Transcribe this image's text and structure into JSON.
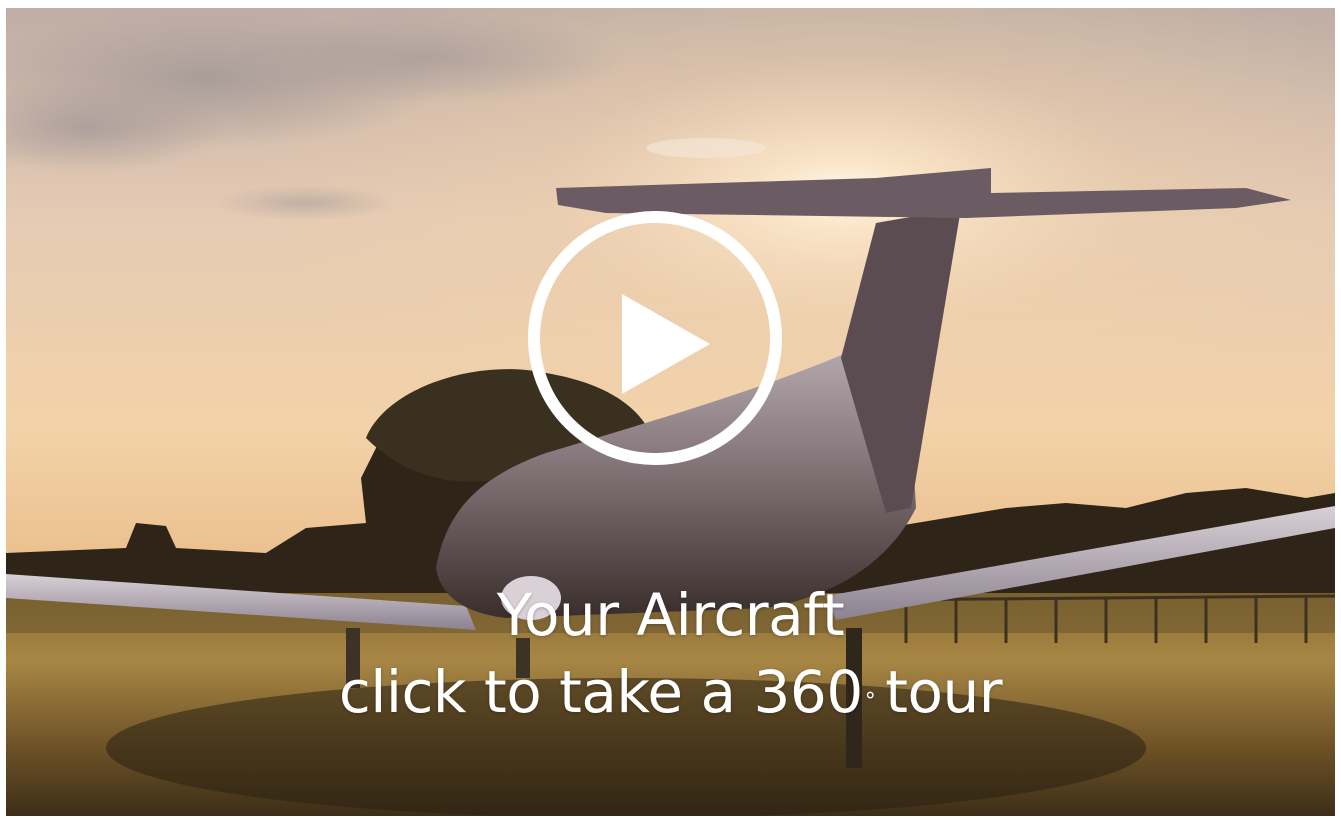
{
  "video": {
    "title": "Your Aircraft",
    "subtitle_pre": "click to take a 360",
    "degree_symbol": "°",
    "subtitle_post": "tour"
  },
  "icons": {
    "play": "play-circle-icon"
  },
  "colors": {
    "overlay_text": "#ffffff",
    "sky_top": "#c8b4a0",
    "sky_glow": "#f4dcbd",
    "ground": "#a07a3a",
    "foliage": "#2c2418"
  }
}
